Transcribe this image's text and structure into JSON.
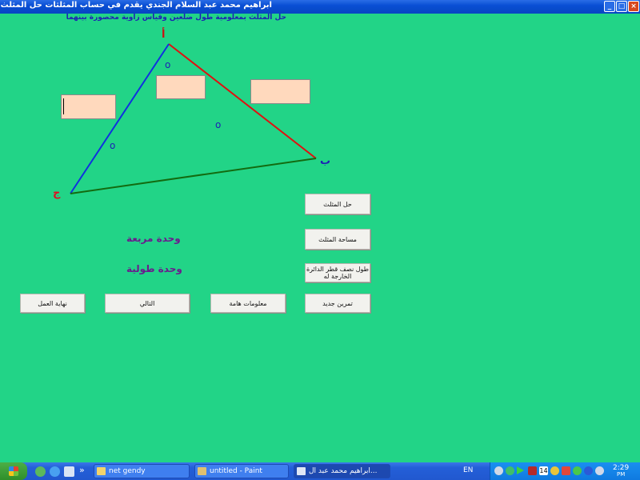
{
  "window": {
    "title": "ابراهيم محمد عبد السلام الجندي يقدم في حساب المثلثات   حل المثلث",
    "min_glyph": "_",
    "max_glyph": "□",
    "close_glyph": "×"
  },
  "subtitle": "حل المثلث بمعلومية طول ضلعين وقياس زاوية محصورة بينهما",
  "triangle": {
    "vertex_a": "أ",
    "vertex_b": "ب",
    "vertex_c": "ج",
    "angle_mark_a": "o",
    "angle_mark_b": "o",
    "angle_mark_c": "o",
    "side_ab_color": "#e01010",
    "side_ac_color": "#1030e0",
    "side_bc_color": "#136b10"
  },
  "buttons": {
    "solve": "حل المثلث",
    "area": "مساحة المثلث",
    "circumradius": "طول نصف قطر الدائرة الخارجة له",
    "new_exercise": "تمرين جديد",
    "important_info": "معلومات هامة",
    "next": "التالي",
    "end": "نهاية العمل"
  },
  "units": {
    "square_unit": "وحدة مربعة",
    "length_unit": "وحدة طولية"
  },
  "taskbar": {
    "tasks": [
      {
        "label": "net gendy"
      },
      {
        "label": "untitled - Paint"
      },
      {
        "label": "ابراهيم محمد عبد ال..."
      }
    ],
    "overflow": "»",
    "language": "EN",
    "tray_badge": "14",
    "clock_time": "2:29",
    "clock_ampm": "PM"
  },
  "colors": {
    "background": "#22d487",
    "input_fill": "#ffd9bd",
    "unit_text": "#6a1b8e",
    "subtitle_text": "#1d1fb5"
  }
}
